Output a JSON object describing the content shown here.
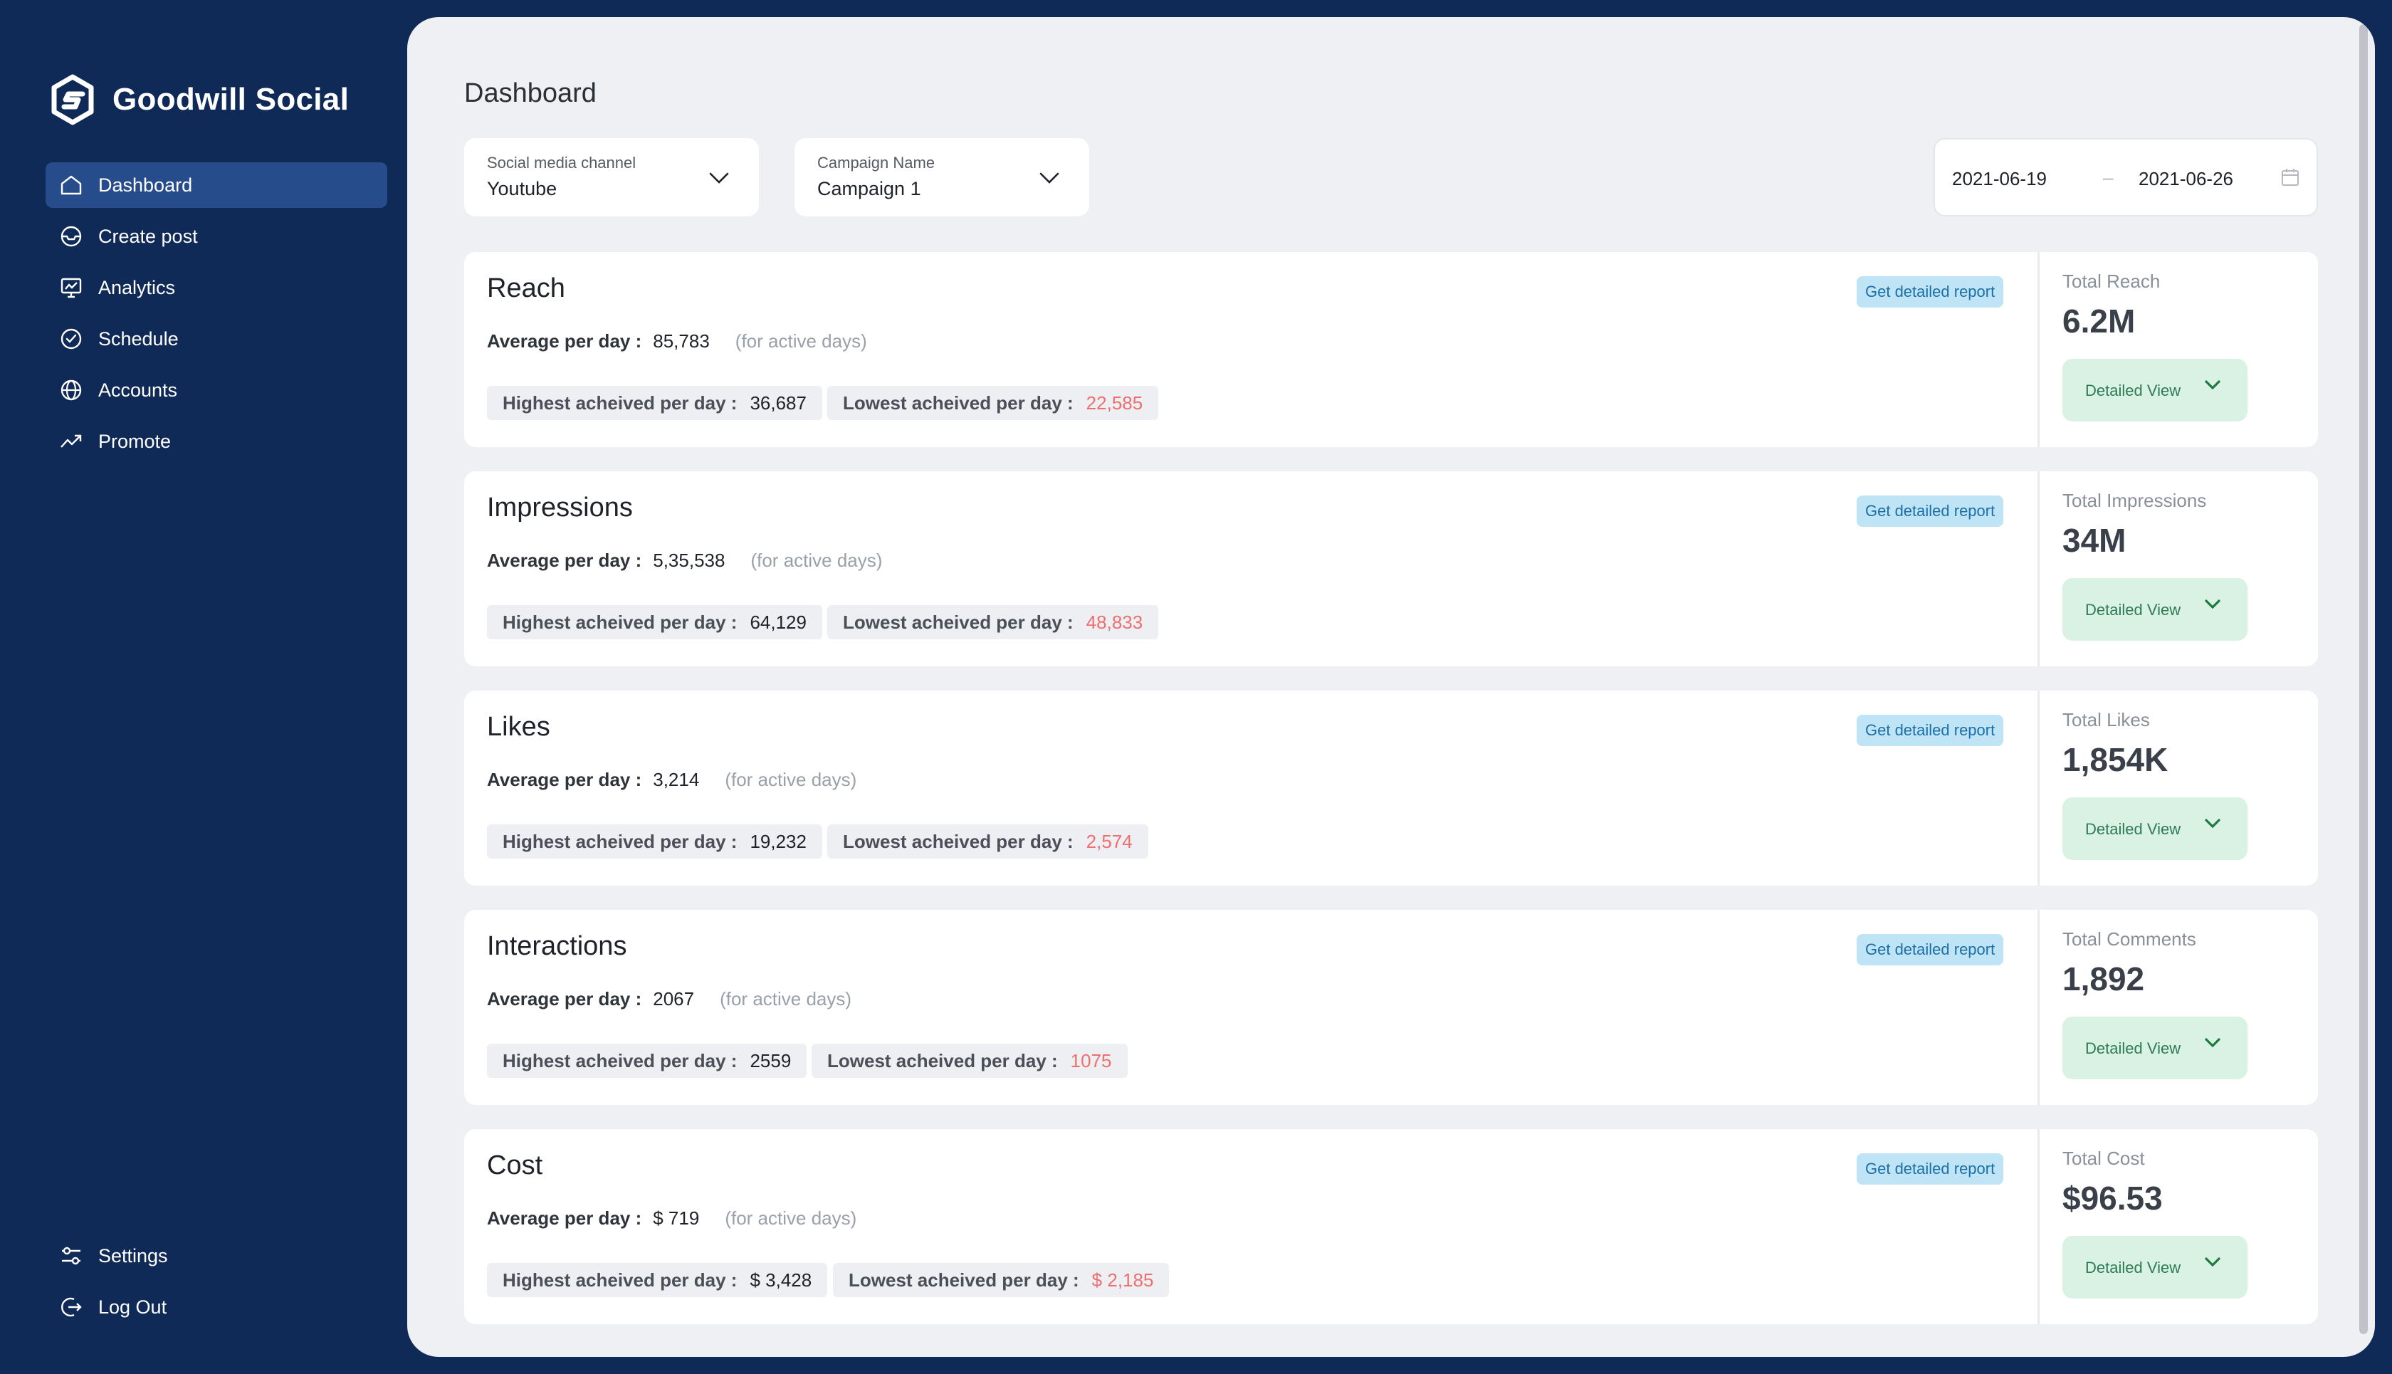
{
  "app": {
    "name": "Goodwill Social"
  },
  "nav": {
    "items": [
      {
        "label": "Dashboard",
        "icon": "home-icon",
        "active": true
      },
      {
        "label": "Create post",
        "icon": "inbox-icon",
        "active": false
      },
      {
        "label": "Analytics",
        "icon": "presentation-chart-icon",
        "active": false
      },
      {
        "label": "Schedule",
        "icon": "check-circle-icon",
        "active": false
      },
      {
        "label": "Accounts",
        "icon": "globe-icon",
        "active": false
      },
      {
        "label": "Promote",
        "icon": "trending-up-icon",
        "active": false
      }
    ],
    "bottom": [
      {
        "label": "Settings",
        "icon": "sliders-icon"
      },
      {
        "label": "Log Out",
        "icon": "logout-icon"
      }
    ]
  },
  "page": {
    "title": "Dashboard"
  },
  "filters": {
    "channel": {
      "label": "Social media channel",
      "value": "Youtube"
    },
    "campaign": {
      "label": "Campaign Name",
      "value": "Campaign 1"
    },
    "date_range": {
      "start": "2021-06-19",
      "separator": "–",
      "end": "2021-06-26"
    }
  },
  "common": {
    "report_label": "Get detailed report",
    "avg_label": "Average per day :",
    "active_note": "(for active days)",
    "highest_label": "Highest acheived per day :",
    "lowest_label": "Lowest acheived per day :",
    "detail_label": "Detailed View"
  },
  "cards": [
    {
      "title": "Reach",
      "avg": "85,783",
      "highest": "36,687",
      "lowest": "22,585",
      "total_label": "Total Reach",
      "total": "6.2M"
    },
    {
      "title": "Impressions",
      "avg": "5,35,538",
      "highest": "64,129",
      "lowest": "48,833",
      "total_label": "Total Impressions",
      "total": "34M"
    },
    {
      "title": "Likes",
      "avg": "3,214",
      "highest": "19,232",
      "lowest": "2,574",
      "total_label": "Total Likes",
      "total": "1,854K"
    },
    {
      "title": "Interactions",
      "avg": "2067",
      "highest": "2559",
      "lowest": "1075",
      "total_label": "Total Comments",
      "total": "1,892"
    },
    {
      "title": "Cost",
      "avg": "$ 719",
      "highest": "$ 3,428",
      "lowest": "$ 2,185",
      "total_label": "Total Cost",
      "total": "$96.53"
    }
  ],
  "colors": {
    "sidebar_bg": "#102a57",
    "nav_active": "#264c8c",
    "report_btn_bg": "#bfe4f6",
    "detail_btn_bg": "#d9f2e3",
    "lowest_value": "#ef6f6f"
  }
}
